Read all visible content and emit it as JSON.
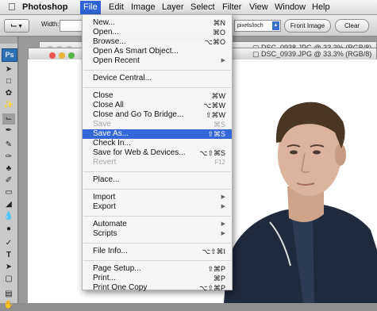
{
  "menubar": {
    "items": [
      "Photoshop",
      "File",
      "Edit",
      "Image",
      "Layer",
      "Select",
      "Filter",
      "View",
      "Window",
      "Help"
    ]
  },
  "options_bar": {
    "width_label": "Width:",
    "units_value": "pixels/inch",
    "front_image_label": "Front Image",
    "clear_label": "Clear"
  },
  "tools_panel": {
    "badge": "Ps"
  },
  "documents": [
    {
      "title": "DSC_0938.JPG @ 33.3% (RGB/8)"
    },
    {
      "title": "DSC_0939.JPG @ 33.3% (RGB/8)"
    }
  ],
  "file_menu": {
    "items": [
      {
        "label": "New...",
        "shortcut": "⌘N",
        "state": "normal"
      },
      {
        "label": "Open...",
        "shortcut": "⌘O",
        "state": "normal"
      },
      {
        "label": "Browse...",
        "shortcut": "⌥⌘O",
        "state": "normal"
      },
      {
        "label": "Open As Smart Object...",
        "shortcut": "",
        "state": "normal"
      },
      {
        "label": "Open Recent",
        "shortcut": "▶",
        "state": "normal"
      },
      {
        "label": "Device Central...",
        "shortcut": "",
        "state": "normal"
      },
      {
        "label": "Close",
        "shortcut": "⌘W",
        "state": "normal"
      },
      {
        "label": "Close All",
        "shortcut": "⌥⌘W",
        "state": "normal"
      },
      {
        "label": "Close and Go To Bridge...",
        "shortcut": "⇧⌘W",
        "state": "normal"
      },
      {
        "label": "Save",
        "shortcut": "⌘S",
        "state": "disabled"
      },
      {
        "label": "Save As...",
        "shortcut": "⇧⌘S",
        "state": "highlighted"
      },
      {
        "label": "Check In...",
        "shortcut": "",
        "state": "normal"
      },
      {
        "label": "Save for Web & Devices...",
        "shortcut": "⌥⇧⌘S",
        "state": "normal"
      },
      {
        "label": "Revert",
        "shortcut": "F12",
        "state": "disabled"
      },
      {
        "label": "Place...",
        "shortcut": "",
        "state": "normal"
      },
      {
        "label": "Import",
        "shortcut": "▶",
        "state": "normal"
      },
      {
        "label": "Export",
        "shortcut": "▶",
        "state": "normal"
      },
      {
        "label": "Automate",
        "shortcut": "▶",
        "state": "normal"
      },
      {
        "label": "Scripts",
        "shortcut": "▶",
        "state": "normal"
      },
      {
        "label": "File Info...",
        "shortcut": "⌥⇧⌘I",
        "state": "normal"
      },
      {
        "label": "Page Setup...",
        "shortcut": "⇧⌘P",
        "state": "normal"
      },
      {
        "label": "Print...",
        "shortcut": "⌘P",
        "state": "normal"
      },
      {
        "label": "Print One Copy",
        "shortcut": "⌥⇧⌘P",
        "state": "normal"
      }
    ]
  }
}
